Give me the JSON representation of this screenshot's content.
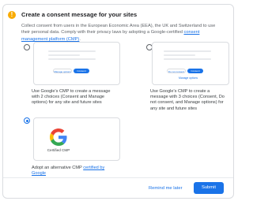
{
  "header": {
    "warning_icon_glyph": "!",
    "title": "Create a consent message for your sites"
  },
  "description": {
    "text": "Collect consent from users in the European Economic Area (EEA), the UK and Switzerland to use their personal data. Comply with their privacy laws by adopting a Google-certified ",
    "link": "consent management platform (CMP)",
    "end": "."
  },
  "options": [
    {
      "mock": {
        "left_button": "Manage options",
        "right_button": "Consent"
      },
      "text": "Use Google's CMP to create a message with 2 choices (Consent and Manage options) for any site and future sites",
      "selected": false
    },
    {
      "mock": {
        "left_button": "Do not consent",
        "right_button": "Consent",
        "link": "Manage options"
      },
      "text": "Use Google's CMP to create a message with 3 choices (Consent, Do not consent, and Manage options) for any site and future sites",
      "selected": false
    },
    {
      "card_label": "Certified CMP",
      "text": "Adopt an alternative CMP ",
      "link": "certified by Google",
      "selected": true
    }
  ],
  "footer": {
    "remind_label": "Remind me later",
    "submit_label": "Submit"
  },
  "colors": {
    "accent": "#1a73e8",
    "warning": "#f9ab00"
  }
}
